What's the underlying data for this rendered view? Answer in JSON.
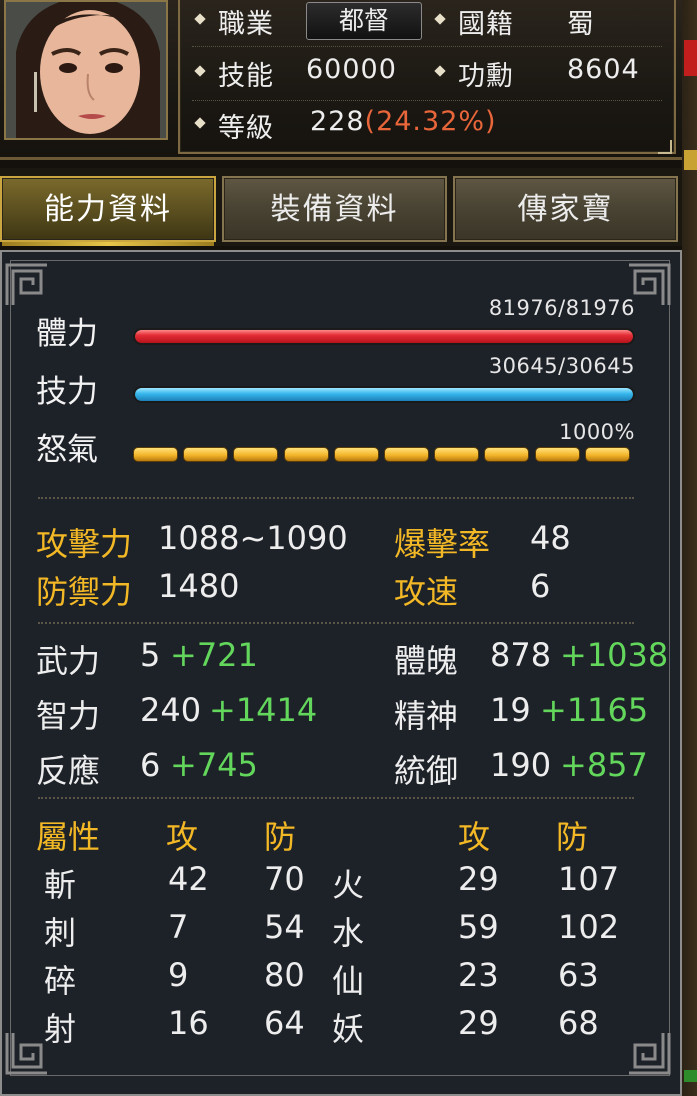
{
  "header": {
    "job_label": "職業",
    "job_value": "都督",
    "nation_label": "國籍",
    "nation_value": "蜀",
    "skill_label": "技能",
    "skill_value": "60000",
    "merit_label": "功勳",
    "merit_value": "8604",
    "level_label": "等級",
    "level_value": "228",
    "level_pct": "(24.32%)"
  },
  "tabs": [
    {
      "label": "能力資料",
      "active": true
    },
    {
      "label": "裝備資料",
      "active": false
    },
    {
      "label": "傳家寶",
      "active": false
    }
  ],
  "bars": {
    "hp": {
      "label": "體力",
      "value_text": "81976/81976",
      "current": 81976,
      "max": 81976
    },
    "mp": {
      "label": "技力",
      "value_text": "30645/30645",
      "current": 30645,
      "max": 30645
    },
    "rage": {
      "label": "怒氣",
      "value_text": "1000%",
      "segments_total": 10,
      "segments_filled": 10
    }
  },
  "combat": {
    "attack_label": "攻擊力",
    "attack_value": "1088~1090",
    "crit_label": "爆擊率",
    "crit_value": "48",
    "defense_label": "防禦力",
    "defense_value": "1480",
    "speed_label": "攻速",
    "speed_value": "6"
  },
  "attributes": {
    "left": [
      {
        "label": "武力",
        "base": "5",
        "bonus": "+721"
      },
      {
        "label": "智力",
        "base": "240",
        "bonus": "+1414"
      },
      {
        "label": "反應",
        "base": "6",
        "bonus": "+745"
      }
    ],
    "right": [
      {
        "label": "體魄",
        "base": "878",
        "bonus": "+1038"
      },
      {
        "label": "精神",
        "base": "19",
        "bonus": "+1165"
      },
      {
        "label": "統御",
        "base": "190",
        "bonus": "+857"
      }
    ]
  },
  "elements": {
    "header_attr": "屬性",
    "header_atk": "攻",
    "header_def": "防",
    "header_atk2": "攻",
    "header_def2": "防",
    "rows": [
      {
        "a": "斬",
        "a_atk": "42",
        "a_def": "70",
        "b": "火",
        "b_atk": "29",
        "b_def": "107"
      },
      {
        "a": "刺",
        "a_atk": "7",
        "a_def": "54",
        "b": "水",
        "b_atk": "59",
        "b_def": "102"
      },
      {
        "a": "碎",
        "a_atk": "9",
        "a_def": "80",
        "b": "仙",
        "b_atk": "23",
        "b_def": "63"
      },
      {
        "a": "射",
        "a_atk": "16",
        "a_def": "64",
        "b": "妖",
        "b_atk": "29",
        "b_def": "68"
      }
    ]
  },
  "colors": {
    "gold_label": "#f3b825",
    "bonus_green": "#63d65c",
    "level_pct": "#e9663b",
    "hp_bar": "#e52d36",
    "mp_bar": "#35b6ec",
    "rage_bar": "#f4b52a"
  }
}
